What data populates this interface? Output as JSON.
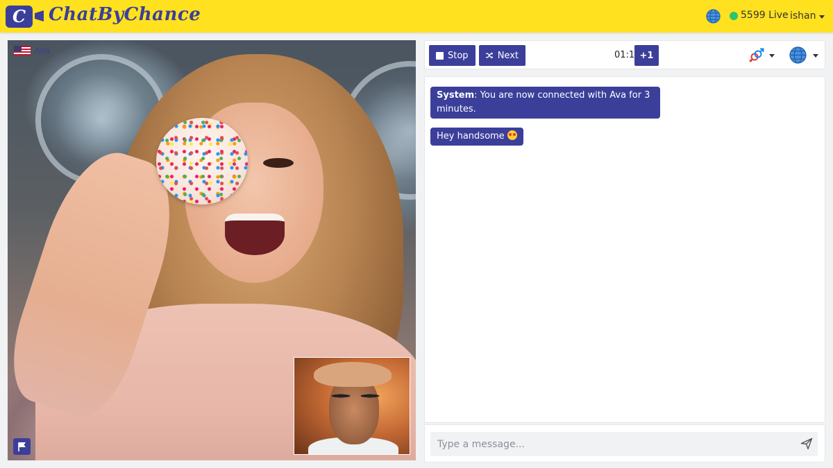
{
  "header": {
    "logo_letter": "C",
    "brand_name": "ChatByChance",
    "live_count": "5599 Live",
    "username": "ishan",
    "icons": [
      "globe-icon",
      "caret-down-icon",
      "video-camera-icon"
    ]
  },
  "remote": {
    "name": "Ava",
    "country_flag": "us-flag-icon",
    "report_icon": "flag-icon"
  },
  "toolbar": {
    "stop_label": "Stop",
    "next_label": "Next",
    "timer": "01:11",
    "extend_label": "+1",
    "icons": [
      "stop-icon",
      "shuffle-icon",
      "gender-icon",
      "globe-icon"
    ]
  },
  "chat": {
    "messages": [
      {
        "sender": "System",
        "sender_label": "System",
        "text": ": You are now connected with Ava for 3 minutes."
      },
      {
        "sender": "Ava",
        "text": "Hey handsome",
        "emoji": "star-struck-emoji"
      }
    ]
  },
  "composer": {
    "placeholder": "Type a message...",
    "send_icon": "send-icon"
  },
  "colors": {
    "header_bg": "#ffe11f",
    "accent": "#3b3f9a",
    "live_dot": "#2fc36d",
    "page_bg": "#f1f2f4"
  }
}
